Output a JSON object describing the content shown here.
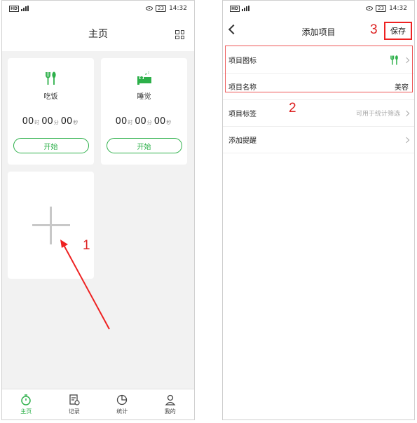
{
  "left_screen": {
    "status": {
      "network": "HD",
      "signal_label": "5G",
      "battery": "23",
      "time": "14:32"
    },
    "title": "主页",
    "cards": [
      {
        "icon": "fork-knife-icon",
        "name": "吃饭",
        "hours": "00",
        "minutes": "00",
        "seconds": "00",
        "button": "开始"
      },
      {
        "icon": "bed-icon",
        "name": "睡觉",
        "hours": "00",
        "minutes": "00",
        "seconds": "00",
        "button": "开始"
      }
    ],
    "units": {
      "hour": "时",
      "minute": "分",
      "second": "秒"
    },
    "tabs": [
      {
        "label": "主页",
        "icon": "stopwatch-icon",
        "active": true
      },
      {
        "label": "记录",
        "icon": "record-icon",
        "active": false
      },
      {
        "label": "统计",
        "icon": "pie-chart-icon",
        "active": false
      },
      {
        "label": "我的",
        "icon": "user-icon",
        "active": false
      }
    ]
  },
  "right_screen": {
    "status": {
      "network": "HD",
      "signal_label": "5G",
      "battery": "23",
      "time": "14:32"
    },
    "title": "添加项目",
    "save": "保存",
    "rows": [
      {
        "label": "项目图标",
        "value": "",
        "icon": "fork-knife-icon"
      },
      {
        "label": "项目名称",
        "value": "美容"
      },
      {
        "label": "项目标签",
        "value": "可用于统计筛选"
      },
      {
        "label": "添加提醒",
        "value": ""
      }
    ]
  },
  "annotations": {
    "step1": "1",
    "step2": "2",
    "step3": "3"
  },
  "colors": {
    "accent": "#2db04a",
    "annotation": "#e22222"
  }
}
